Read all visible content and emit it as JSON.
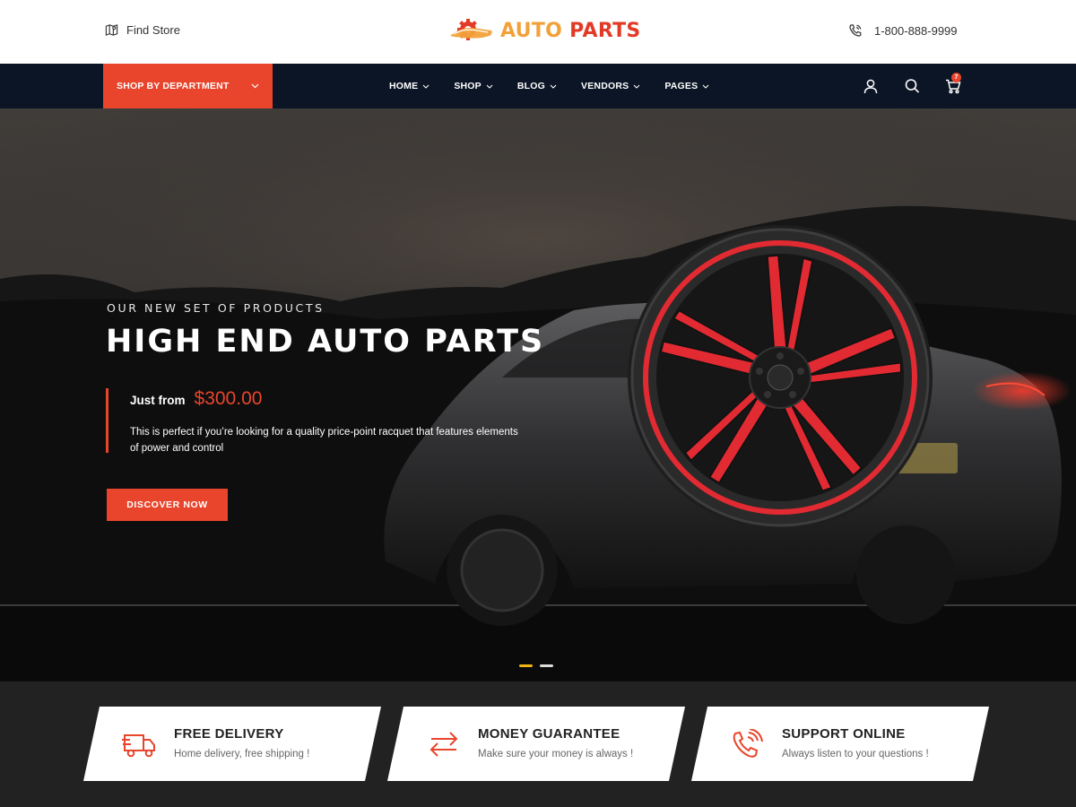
{
  "header": {
    "find_store": "Find Store",
    "logo_part1": "AUTO",
    "logo_part2": "PARTS",
    "phone": "1-800-888-9999",
    "icons": {
      "find_store": "map-pin-icon",
      "logo": "gear-car-logo-icon",
      "phone": "phone-icon"
    }
  },
  "nav": {
    "department_label": "SHOP BY DEPARTMENT",
    "items": [
      {
        "label": "HOME"
      },
      {
        "label": "SHOP"
      },
      {
        "label": "BLOG"
      },
      {
        "label": "VENDORS"
      },
      {
        "label": "PAGES"
      }
    ],
    "cart_count": "7",
    "icons": {
      "account": "user-icon",
      "search": "search-icon",
      "cart": "cart-icon",
      "chevron": "chevron-down-icon"
    }
  },
  "hero": {
    "subtitle": "OUR NEW SET OF PRODUCTS",
    "title": "HIGH END AUTO PARTS",
    "price_label": "Just from",
    "price_value": "$300.00",
    "description": "This is perfect if you’re looking for a quality price-point racquet that features elements of power and control",
    "cta_label": "DISCOVER NOW",
    "slides": [
      {
        "active": true
      },
      {
        "active": false
      }
    ]
  },
  "features": [
    {
      "title": "FREE DELIVERY",
      "description": "Home delivery, free shipping !",
      "icon": "truck-icon"
    },
    {
      "title": "MONEY GUARANTEE",
      "description": "Make sure your money is always !",
      "icon": "exchange-arrows-icon"
    },
    {
      "title": "SUPPORT ONLINE",
      "description": "Always listen to your questions !",
      "icon": "support-phone-icon"
    }
  ],
  "colors": {
    "accent": "#e8452c",
    "logo_orange": "#f2a13a",
    "nav_background": "#0b1525",
    "slider_active": "#f0b515"
  }
}
